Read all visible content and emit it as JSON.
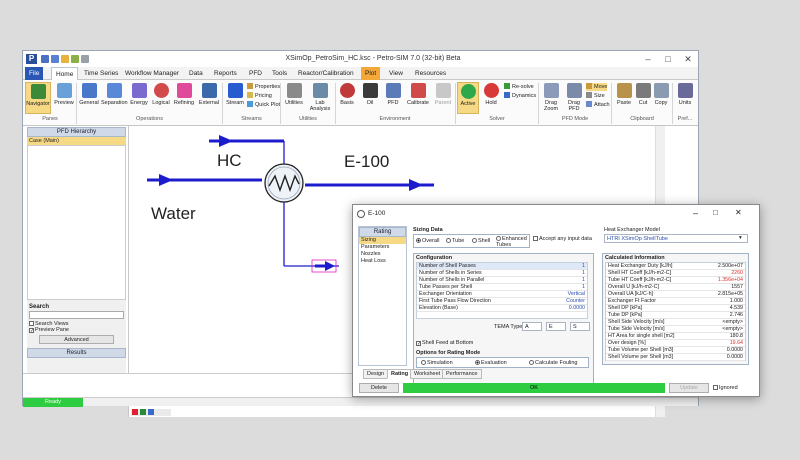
{
  "window": {
    "title": "XSimOp_PetroSim_HC.ksc - Petro-SIM 7.0 (32-bit) Beta",
    "logo": "P"
  },
  "menu": {
    "tabs": [
      "File",
      "Home",
      "Time Series",
      "Workflow Manager",
      "Data",
      "Reports",
      "PFD",
      "Tools",
      "Reactor/Calibration",
      "Plot",
      "View",
      "Resources"
    ]
  },
  "ribbon": {
    "panes": {
      "label": "Panes",
      "navigator": "Navigator",
      "preview": "Preview"
    },
    "operations": {
      "label": "Operations",
      "items": [
        "General",
        "Separation",
        "Energy",
        "Logical",
        "Refining",
        "External"
      ]
    },
    "streams": {
      "label": "Streams",
      "stream": "Stream",
      "properties": "Properties",
      "pricing": "Pricing",
      "quick_plot": "Quick Plot"
    },
    "utilities": {
      "label": "Utilities",
      "utilities": "Utilities",
      "lab_analysis": "Lab Analysis"
    },
    "environment": {
      "label": "Environment",
      "items": [
        "Basis",
        "Oil",
        "PFD",
        "Calibrate",
        "Parent"
      ]
    },
    "solver": {
      "label": "Solver",
      "active": "Active",
      "hold": "Hold",
      "re_solve": "Re-solve",
      "dynamics": "Dynamics"
    },
    "pfd_mode": {
      "label": "PFD Mode",
      "drag_zoom": "Drag Zoom",
      "drag_pfd": "Drag PFD",
      "move": "Move",
      "size": "Size",
      "attach": "Attach"
    },
    "clipboard": {
      "label": "Clipboard",
      "paste": "Paste",
      "cut": "Cut",
      "copy": "Copy"
    },
    "pref": {
      "label": "Pref...",
      "units": "Units"
    }
  },
  "left_panel": {
    "hierarchy_title": "PFD Hierarchy",
    "hierarchy_item": "Case (Main)",
    "search_title": "Search",
    "search_views": "Search Views",
    "preview_pane": "Preview Pane",
    "advanced": "Advanced",
    "results_title": "Results"
  },
  "pfd": {
    "hc_label": "HC",
    "water_label": "Water",
    "unit_label": "E-100"
  },
  "status": {
    "ready": "Ready"
  },
  "dialog": {
    "title": "E-100",
    "nav_header": "Rating",
    "nav_items": [
      "Sizing",
      "Parameters",
      "Nozzles",
      "Heat Loss"
    ],
    "sizing_title": "Sizing Data",
    "sizing_options": [
      "Overall",
      "Tube",
      "Shell",
      "Enhanced Tubes"
    ],
    "accept_input": "Accept any input data",
    "model_title": "Heat Exchanger Model",
    "model_value": "HTRI XSimOp ShellTube",
    "config_title": "Configuration",
    "config_rows": [
      {
        "k": "Number of Shell Passes",
        "v": "1"
      },
      {
        "k": "Number of Shells in Series",
        "v": "1"
      },
      {
        "k": "Number of Shells in Parallel",
        "v": "1"
      },
      {
        "k": "Tube Passes per Shell",
        "v": "1"
      },
      {
        "k": "Exchanger Orientation",
        "v": "Vertical"
      },
      {
        "k": "First Tube Pass Flow Direction",
        "v": "Counter"
      },
      {
        "k": "Elevation (Base)",
        "v": "0.0000"
      }
    ],
    "tema_label": "TEMA Type",
    "tema_values": [
      "A",
      "E",
      "S"
    ],
    "shell_feed": "Shell Feed at Bottom",
    "rating_mode_title": "Options for Rating Mode",
    "rating_modes": [
      "Simulation",
      "Evaluation",
      "Calculate Fouling"
    ],
    "calc_title": "Calculated Information",
    "calc_rows": [
      {
        "k": "Heat Exchanger Duty [kJ/h]",
        "v": "2.500e+07",
        "c": ""
      },
      {
        "k": "Shell HT Coeff [kJ/h-m2-C]",
        "v": "2260",
        "c": "red"
      },
      {
        "k": "Tube HT Coeff [kJ/h-m2-C]",
        "v": "1.356e+04",
        "c": "red"
      },
      {
        "k": "Overall U [kJ/h-m2-C]",
        "v": "1557",
        "c": ""
      },
      {
        "k": "Overall UA [kJ/C-h]",
        "v": "2.815e+05",
        "c": ""
      },
      {
        "k": "Exchanger Ft Factor",
        "v": "1.000",
        "c": ""
      },
      {
        "k": "Shell DP [kPa]",
        "v": "4.539",
        "c": ""
      },
      {
        "k": "Tube DP [kPa]",
        "v": "2.746",
        "c": ""
      },
      {
        "k": "Shell Side Velocity [m/s]",
        "v": "<empty>",
        "c": ""
      },
      {
        "k": "Tube Side Velocity [m/s]",
        "v": "<empty>",
        "c": ""
      },
      {
        "k": "HT Area for single shell [m2]",
        "v": "180.8",
        "c": ""
      },
      {
        "k": "Over design [%]",
        "v": "19.64",
        "c": "red"
      },
      {
        "k": "Tube Volume per Shell [m3]",
        "v": "0.0000",
        "c": ""
      },
      {
        "k": "Shell Volume per Shell [m3]",
        "v": "0.0000",
        "c": ""
      }
    ],
    "tabs": [
      "Design",
      "Rating",
      "Worksheet",
      "Performance"
    ],
    "delete": "Delete",
    "ok": "OK",
    "update": "Update",
    "ignored": "Ignored"
  },
  "colors": {
    "accent": "#2a57b3",
    "stream": "#1c1ccc",
    "ok_green": "#2ecc40",
    "selected": "#f6d985"
  }
}
